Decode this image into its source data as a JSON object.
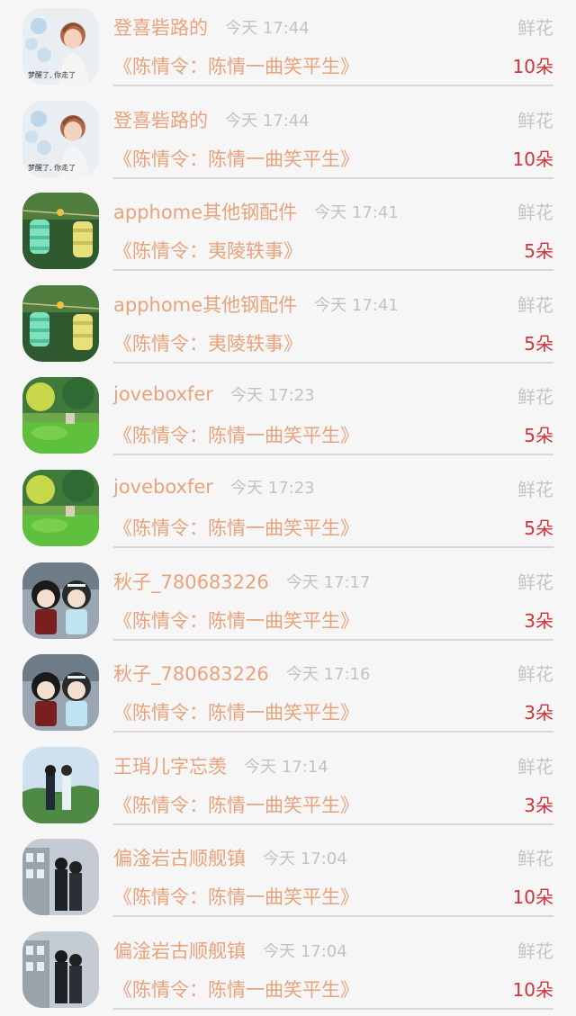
{
  "gift_label": "鲜花",
  "unit": "朵",
  "records": [
    {
      "user": "登喜砦路的",
      "time": "今天 17:44",
      "book": "《陈情令：陈情一曲笑平生》",
      "count": "10朵",
      "avatar": "girl-icon"
    },
    {
      "user": "登喜砦路的",
      "time": "今天 17:44",
      "book": "《陈情令：陈情一曲笑平生》",
      "count": "10朵",
      "avatar": "girl-icon"
    },
    {
      "user": "apphome其他钢配件",
      "time": "今天 17:41",
      "book": "《陈情令：夷陵轶事》",
      "count": "5朵",
      "avatar": "lantern-icon"
    },
    {
      "user": "apphome其他钢配件",
      "time": "今天 17:41",
      "book": "《陈情令：夷陵轶事》",
      "count": "5朵",
      "avatar": "lantern-icon"
    },
    {
      "user": "joveboxfer",
      "time": "今天 17:23",
      "book": "《陈情令：陈情一曲笑平生》",
      "count": "5朵",
      "avatar": "landscape-icon"
    },
    {
      "user": "joveboxfer",
      "time": "今天 17:23",
      "book": "《陈情令：陈情一曲笑平生》",
      "count": "5朵",
      "avatar": "landscape-icon"
    },
    {
      "user": "秋子_780683226",
      "time": "今天 17:17",
      "book": "《陈情令：陈情一曲笑平生》",
      "count": "3朵",
      "avatar": "figurine-icon"
    },
    {
      "user": "秋子_780683226",
      "time": "今天 17:16",
      "book": "《陈情令：陈情一曲笑平生》",
      "count": "3朵",
      "avatar": "figurine-icon"
    },
    {
      "user": "王琑儿字忘羡",
      "time": "今天 17:14",
      "book": "《陈情令：陈情一曲笑平生》",
      "count": "3朵",
      "avatar": "couple-icon"
    },
    {
      "user": "偏淦岩古顺舰镇",
      "time": "今天 17:04",
      "book": "《陈情令：陈情一曲笑平生》",
      "count": "10朵",
      "avatar": "building-couple-icon"
    },
    {
      "user": "偏淦岩古顺舰镇",
      "time": "今天 17:04",
      "book": "《陈情令：陈情一曲笑平生》",
      "count": "10朵",
      "avatar": "building-couple-icon"
    }
  ],
  "colors": {
    "username": "#e7a37b",
    "time": "#c4c1c2",
    "gift": "#c7c3c4",
    "count": "#d0323a",
    "divider": "#d9d6d7",
    "background": "#f7f6f7"
  }
}
